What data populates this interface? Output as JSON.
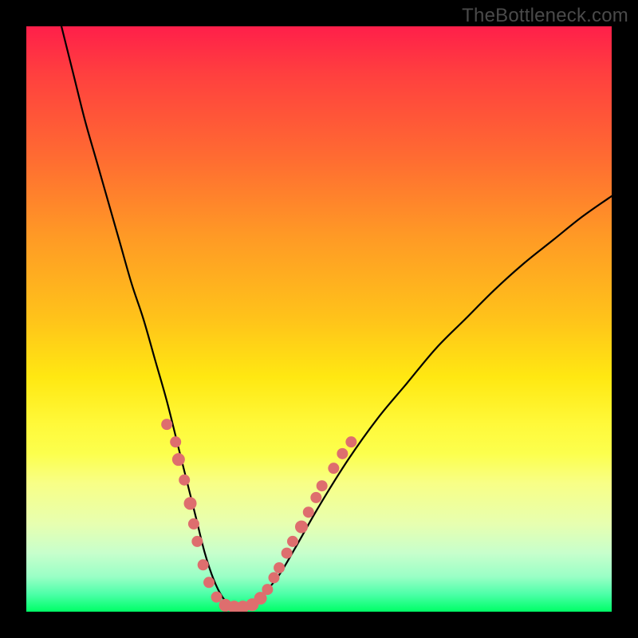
{
  "watermark": "TheBottleneck.com",
  "colors": {
    "frame": "#000000",
    "curve": "#000000",
    "dot_fill": "#de6e6e",
    "dot_stroke": "#c85a5a"
  },
  "chart_data": {
    "type": "line",
    "title": "",
    "xlabel": "",
    "ylabel": "",
    "xlim": [
      0,
      100
    ],
    "ylim": [
      0,
      100
    ],
    "series": [
      {
        "name": "bottleneck-curve",
        "x": [
          6,
          8,
          10,
          12,
          14,
          16,
          18,
          20,
          22,
          24,
          26,
          27.5,
          29,
          30.5,
          32,
          33.5,
          35,
          36,
          37,
          38,
          40,
          43,
          46,
          50,
          55,
          60,
          65,
          70,
          75,
          80,
          85,
          90,
          95,
          100
        ],
        "y": [
          100,
          92,
          84,
          77,
          70,
          63,
          56,
          50,
          43,
          36,
          28,
          22,
          16,
          10,
          5.5,
          2.5,
          1,
          0.6,
          0.6,
          1,
          2.5,
          6,
          11,
          18,
          26,
          33,
          39,
          45,
          50,
          55,
          59.5,
          63.5,
          67.5,
          71
        ]
      }
    ],
    "dots_cluster": {
      "name": "highlighted-points",
      "points": [
        {
          "x": 24.0,
          "y": 32.0,
          "r": 7
        },
        {
          "x": 25.5,
          "y": 29.0,
          "r": 7
        },
        {
          "x": 26.0,
          "y": 26.0,
          "r": 8
        },
        {
          "x": 27.0,
          "y": 22.5,
          "r": 7
        },
        {
          "x": 28.0,
          "y": 18.5,
          "r": 8
        },
        {
          "x": 28.6,
          "y": 15.0,
          "r": 7
        },
        {
          "x": 29.2,
          "y": 12.0,
          "r": 7
        },
        {
          "x": 30.2,
          "y": 8.0,
          "r": 7
        },
        {
          "x": 31.2,
          "y": 5.0,
          "r": 7
        },
        {
          "x": 32.5,
          "y": 2.5,
          "r": 7
        },
        {
          "x": 34.0,
          "y": 1.1,
          "r": 8
        },
        {
          "x": 35.5,
          "y": 0.8,
          "r": 8
        },
        {
          "x": 37.0,
          "y": 0.8,
          "r": 8
        },
        {
          "x": 38.6,
          "y": 1.2,
          "r": 8
        },
        {
          "x": 40.0,
          "y": 2.3,
          "r": 8
        },
        {
          "x": 41.2,
          "y": 3.8,
          "r": 7
        },
        {
          "x": 42.3,
          "y": 5.8,
          "r": 7
        },
        {
          "x": 43.2,
          "y": 7.5,
          "r": 7
        },
        {
          "x": 44.5,
          "y": 10.0,
          "r": 7
        },
        {
          "x": 45.5,
          "y": 12.0,
          "r": 7
        },
        {
          "x": 47.0,
          "y": 14.5,
          "r": 8
        },
        {
          "x": 48.2,
          "y": 17.0,
          "r": 7
        },
        {
          "x": 49.5,
          "y": 19.5,
          "r": 7
        },
        {
          "x": 50.5,
          "y": 21.5,
          "r": 7
        },
        {
          "x": 52.5,
          "y": 24.5,
          "r": 7
        },
        {
          "x": 54.0,
          "y": 27.0,
          "r": 7
        },
        {
          "x": 55.5,
          "y": 29.0,
          "r": 7
        }
      ]
    }
  }
}
